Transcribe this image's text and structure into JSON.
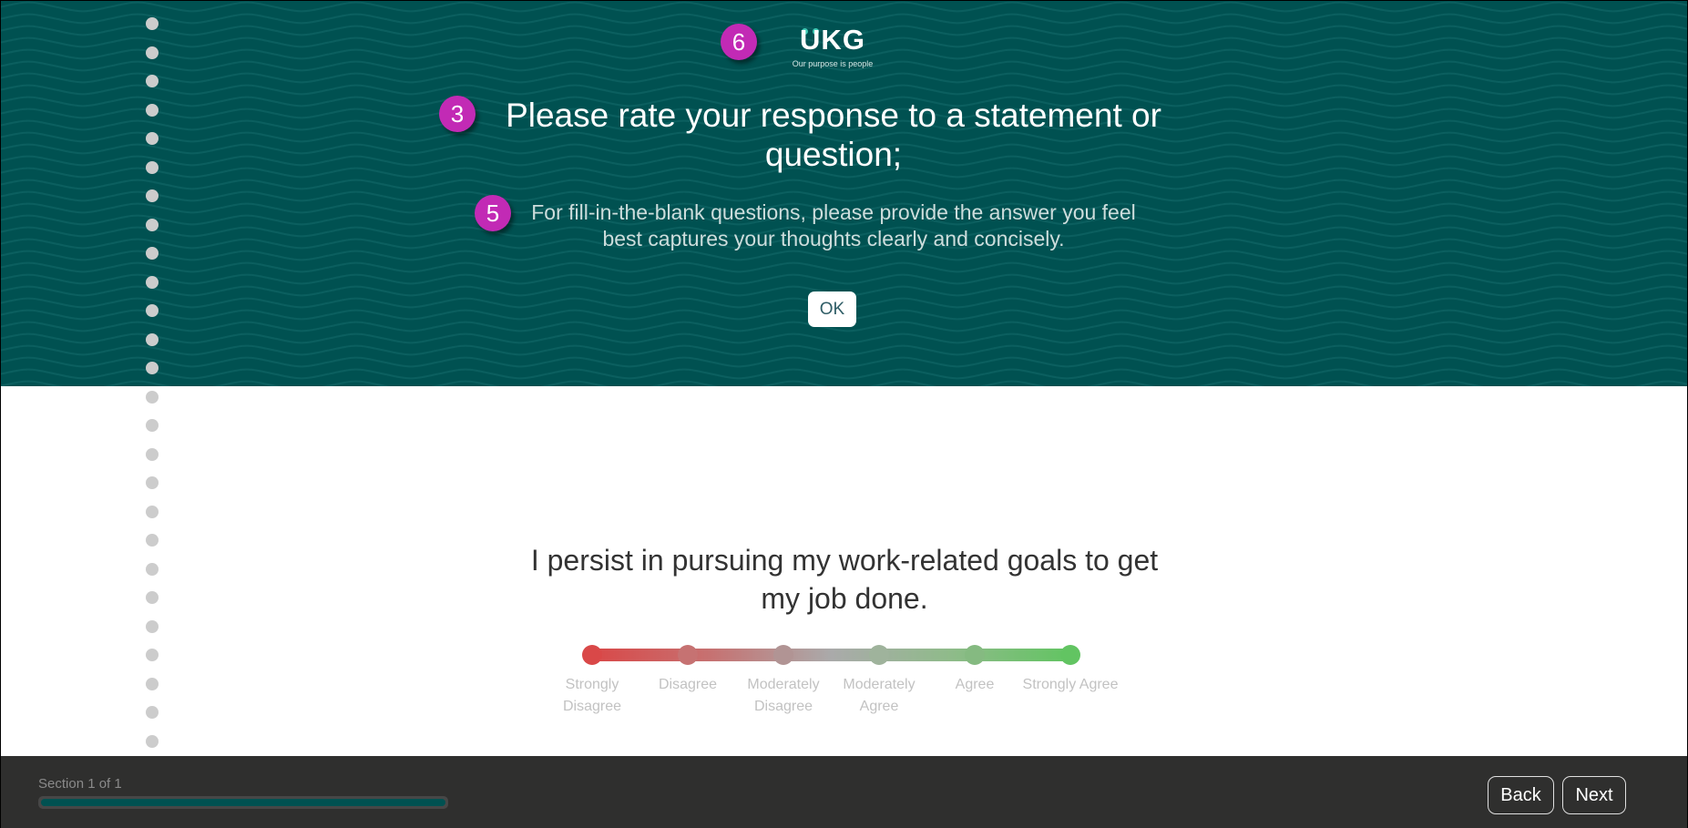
{
  "hero": {
    "background_color": "#005151",
    "logo": {
      "wordmark": "UKG",
      "tagline": "Our purpose is people"
    },
    "title": "Please rate your response to a statement or question;",
    "subtitle": "For fill-in-the-blank questions, please provide the answer you feel best captures your thoughts clearly and concisely.",
    "ok_label": "OK"
  },
  "annotations": [
    {
      "number": "6",
      "target": "logo"
    },
    {
      "number": "3",
      "target": "title"
    },
    {
      "number": "5",
      "target": "subtitle"
    }
  ],
  "annotation_color": "#c22ab5",
  "progress_rail": {
    "dot_count": 26
  },
  "question": {
    "text": "I persist in pursuing my work-related goals to get my job done.",
    "scale": [
      {
        "label": "Strongly Disagree",
        "color": "#d94848"
      },
      {
        "label": "Disagree",
        "color": "#c67272"
      },
      {
        "label": "Moderately Disagree",
        "color": "#b19494"
      },
      {
        "label": "Moderately Agree",
        "color": "#9fb39c"
      },
      {
        "label": "Agree",
        "color": "#85ba81"
      },
      {
        "label": "Strongly Agree",
        "color": "#62c462"
      }
    ],
    "selected": null
  },
  "footer": {
    "section_label": "Section 1 of 1",
    "progress_percent": 100,
    "back_label": "Back",
    "next_label": "Next"
  }
}
